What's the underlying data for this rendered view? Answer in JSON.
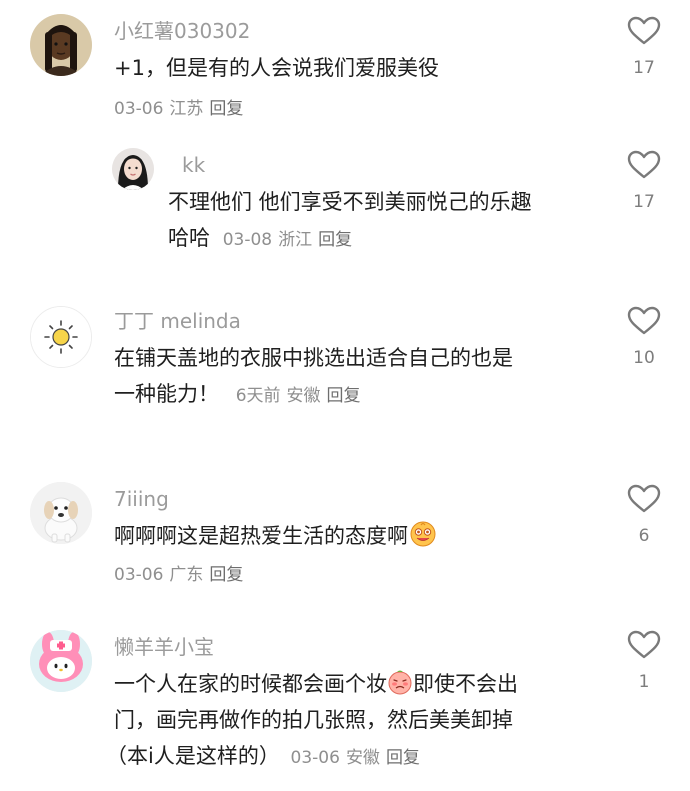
{
  "comments": [
    {
      "username": "小红薯030302",
      "text_lines": [
        "+1，但是有的人会说我们爱服美役"
      ],
      "date": "03-06",
      "location": "江苏",
      "reply": "回复",
      "likes": "17",
      "avatar_icon": "woman-with-braids-avatar"
    },
    {
      "username": "kk",
      "text_lines": [
        "不理他们 他们享受不到美丽悦己的乐趣",
        "哈哈"
      ],
      "date": "03-08",
      "location": "浙江",
      "reply": "回复",
      "likes": "17",
      "avatar_icon": "girl-photo-avatar",
      "is_reply": true
    },
    {
      "username": "丁丁 melinda",
      "text_lines": [
        "在铺天盖地的衣服中挑选出适合自己的也是",
        "一种能力！"
      ],
      "date": "6天前",
      "location": "安徽",
      "reply": "回复",
      "likes": "10",
      "avatar_icon": "sun-avatar"
    },
    {
      "username": "7iiing",
      "text_lines": [
        "啊啊啊这是超热爱生活的态度啊"
      ],
      "date": "03-06",
      "location": "广东",
      "reply": "回复",
      "likes": "6",
      "avatar_icon": "puppy-avatar",
      "inline_emoji": "drooling-face-emoji"
    },
    {
      "username": "懒羊羊小宝",
      "text_lines": [
        "一个人在家的时候都会画个妆",
        "即使不会出",
        "门，画完再做作的拍几张照，然后美美卸掉",
        "（本i人是这样的）"
      ],
      "date": "03-06",
      "location": "安徽",
      "reply": "回复",
      "likes": "1",
      "avatar_icon": "my-melody-nurse-avatar",
      "inline_emoji": "shy-face-emoji"
    }
  ],
  "colors": {
    "username": "#9b9b9b",
    "text": "#1f1f1f",
    "meta": "#8f8f8f",
    "heart": "#7a7a7a"
  },
  "icons": {
    "like": "heart-outline-icon"
  }
}
